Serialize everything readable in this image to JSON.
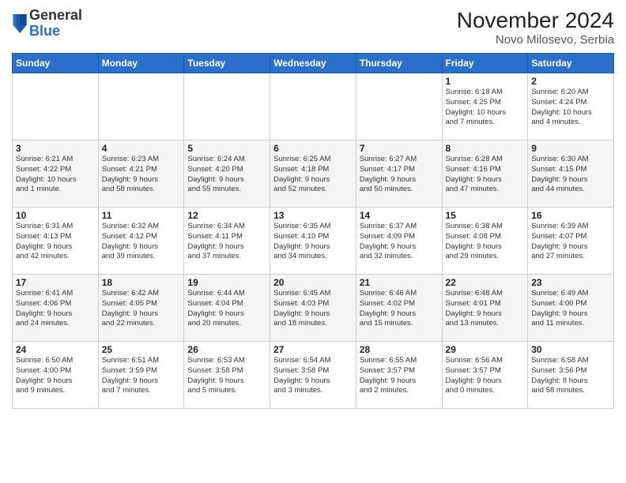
{
  "header": {
    "logo_general": "General",
    "logo_blue": "Blue",
    "month_title": "November 2024",
    "location": "Novo Milosevo, Serbia"
  },
  "weekdays": [
    "Sunday",
    "Monday",
    "Tuesday",
    "Wednesday",
    "Thursday",
    "Friday",
    "Saturday"
  ],
  "weeks": [
    [
      {
        "day": "",
        "info": ""
      },
      {
        "day": "",
        "info": ""
      },
      {
        "day": "",
        "info": ""
      },
      {
        "day": "",
        "info": ""
      },
      {
        "day": "",
        "info": ""
      },
      {
        "day": "1",
        "info": "Sunrise: 6:18 AM\nSunset: 4:25 PM\nDaylight: 10 hours\nand 7 minutes."
      },
      {
        "day": "2",
        "info": "Sunrise: 6:20 AM\nSunset: 4:24 PM\nDaylight: 10 hours\nand 4 minutes."
      }
    ],
    [
      {
        "day": "3",
        "info": "Sunrise: 6:21 AM\nSunset: 4:22 PM\nDaylight: 10 hours\nand 1 minute."
      },
      {
        "day": "4",
        "info": "Sunrise: 6:23 AM\nSunset: 4:21 PM\nDaylight: 9 hours\nand 58 minutes."
      },
      {
        "day": "5",
        "info": "Sunrise: 6:24 AM\nSunset: 4:20 PM\nDaylight: 9 hours\nand 55 minutes."
      },
      {
        "day": "6",
        "info": "Sunrise: 6:25 AM\nSunset: 4:18 PM\nDaylight: 9 hours\nand 52 minutes."
      },
      {
        "day": "7",
        "info": "Sunrise: 6:27 AM\nSunset: 4:17 PM\nDaylight: 9 hours\nand 50 minutes."
      },
      {
        "day": "8",
        "info": "Sunrise: 6:28 AM\nSunset: 4:16 PM\nDaylight: 9 hours\nand 47 minutes."
      },
      {
        "day": "9",
        "info": "Sunrise: 6:30 AM\nSunset: 4:15 PM\nDaylight: 9 hours\nand 44 minutes."
      }
    ],
    [
      {
        "day": "10",
        "info": "Sunrise: 6:31 AM\nSunset: 4:13 PM\nDaylight: 9 hours\nand 42 minutes."
      },
      {
        "day": "11",
        "info": "Sunrise: 6:32 AM\nSunset: 4:12 PM\nDaylight: 9 hours\nand 39 minutes."
      },
      {
        "day": "12",
        "info": "Sunrise: 6:34 AM\nSunset: 4:11 PM\nDaylight: 9 hours\nand 37 minutes."
      },
      {
        "day": "13",
        "info": "Sunrise: 6:35 AM\nSunset: 4:10 PM\nDaylight: 9 hours\nand 34 minutes."
      },
      {
        "day": "14",
        "info": "Sunrise: 6:37 AM\nSunset: 4:09 PM\nDaylight: 9 hours\nand 32 minutes."
      },
      {
        "day": "15",
        "info": "Sunrise: 6:38 AM\nSunset: 4:08 PM\nDaylight: 9 hours\nand 29 minutes."
      },
      {
        "day": "16",
        "info": "Sunrise: 6:39 AM\nSunset: 4:07 PM\nDaylight: 9 hours\nand 27 minutes."
      }
    ],
    [
      {
        "day": "17",
        "info": "Sunrise: 6:41 AM\nSunset: 4:06 PM\nDaylight: 9 hours\nand 24 minutes."
      },
      {
        "day": "18",
        "info": "Sunrise: 6:42 AM\nSunset: 4:05 PM\nDaylight: 9 hours\nand 22 minutes."
      },
      {
        "day": "19",
        "info": "Sunrise: 6:44 AM\nSunset: 4:04 PM\nDaylight: 9 hours\nand 20 minutes."
      },
      {
        "day": "20",
        "info": "Sunrise: 6:45 AM\nSunset: 4:03 PM\nDaylight: 9 hours\nand 18 minutes."
      },
      {
        "day": "21",
        "info": "Sunrise: 6:46 AM\nSunset: 4:02 PM\nDaylight: 9 hours\nand 15 minutes."
      },
      {
        "day": "22",
        "info": "Sunrise: 6:48 AM\nSunset: 4:01 PM\nDaylight: 9 hours\nand 13 minutes."
      },
      {
        "day": "23",
        "info": "Sunrise: 6:49 AM\nSunset: 4:00 PM\nDaylight: 9 hours\nand 11 minutes."
      }
    ],
    [
      {
        "day": "24",
        "info": "Sunrise: 6:50 AM\nSunset: 4:00 PM\nDaylight: 9 hours\nand 9 minutes."
      },
      {
        "day": "25",
        "info": "Sunrise: 6:51 AM\nSunset: 3:59 PM\nDaylight: 9 hours\nand 7 minutes."
      },
      {
        "day": "26",
        "info": "Sunrise: 6:53 AM\nSunset: 3:58 PM\nDaylight: 9 hours\nand 5 minutes."
      },
      {
        "day": "27",
        "info": "Sunrise: 6:54 AM\nSunset: 3:58 PM\nDaylight: 9 hours\nand 3 minutes."
      },
      {
        "day": "28",
        "info": "Sunrise: 6:55 AM\nSunset: 3:57 PM\nDaylight: 9 hours\nand 2 minutes."
      },
      {
        "day": "29",
        "info": "Sunrise: 6:56 AM\nSunset: 3:57 PM\nDaylight: 9 hours\nand 0 minutes."
      },
      {
        "day": "30",
        "info": "Sunrise: 6:58 AM\nSunset: 3:56 PM\nDaylight: 8 hours\nand 58 minutes."
      }
    ]
  ]
}
